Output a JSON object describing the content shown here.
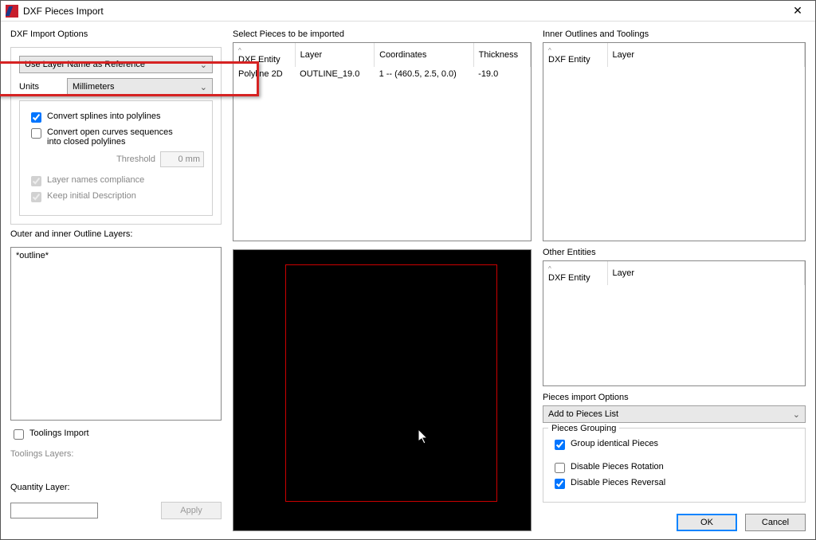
{
  "window": {
    "title": "DXF Pieces Import"
  },
  "left": {
    "import_options_label": "DXF Import Options",
    "reference_select": "Use Layer Name as Reference",
    "units_label": "Units",
    "units_value": "Millimeters",
    "convert_splines": "Convert splines into polylines",
    "convert_open_line1": "Convert open curves sequences",
    "convert_open_line2": "into closed polylines",
    "threshold_label": "Threshold",
    "threshold_value": "0 mm",
    "layer_names_compliance": "Layer names compliance",
    "keep_initial_description": "Keep initial Description",
    "outline_layers_label": "Outer and inner Outline Layers:",
    "outline_layers_value": "*outline*",
    "toolings_import": "Toolings Import",
    "toolings_layers_label": "Toolings Layers:",
    "quantity_layer_label": "Quantity Layer:",
    "apply_btn": "Apply"
  },
  "center": {
    "select_pieces_label": "Select Pieces to be imported",
    "cols": {
      "entity": "DXF Entity",
      "layer": "Layer",
      "coords": "Coordinates",
      "thickness": "Thickness"
    },
    "rows": [
      {
        "entity": "Polyline 2D",
        "layer": "OUTLINE_19.0",
        "coords": "1 -- (460.5, 2.5, 0.0)",
        "thickness": "-19.0"
      }
    ]
  },
  "right": {
    "inner_label": "Inner Outlines and Toolings",
    "cols": {
      "entity": "DXF Entity",
      "layer": "Layer"
    },
    "other_label": "Other Entities",
    "import_options_label": "Pieces import Options",
    "import_action": "Add to Pieces List",
    "grouping_label": "Pieces Grouping",
    "group_identical": "Group identical Pieces",
    "disable_rotation": "Disable Pieces Rotation",
    "disable_reversal": "Disable Pieces Reversal",
    "ok_btn": "OK",
    "cancel_btn": "Cancel"
  }
}
